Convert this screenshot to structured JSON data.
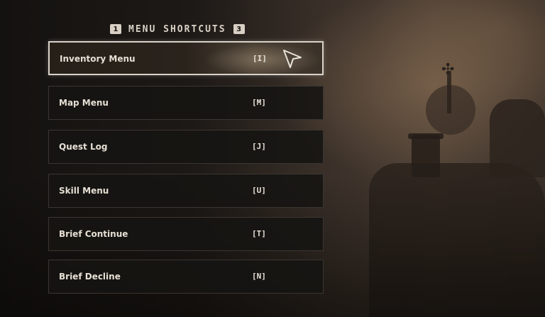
{
  "header": {
    "left_key": "1",
    "title": "MENU SHORTCUTS",
    "right_key": "3"
  },
  "menu": {
    "items": [
      {
        "label": "Inventory Menu",
        "key": "[I]",
        "selected": true
      },
      {
        "label": "Map Menu",
        "key": "[M]",
        "selected": false
      },
      {
        "label": "Quest Log",
        "key": "[J]",
        "selected": false
      },
      {
        "label": "Skill Menu",
        "key": "[U]",
        "selected": false
      },
      {
        "label": "Brief Continue",
        "key": "[T]",
        "selected": false
      },
      {
        "label": "Brief Decline",
        "key": "[N]",
        "selected": false
      }
    ]
  },
  "cursor": {
    "icon": "arrow-pointer-icon"
  },
  "colors": {
    "text": "#e6dfd4",
    "selected_border": "#d8d2c8",
    "row_bg": "#161412"
  }
}
